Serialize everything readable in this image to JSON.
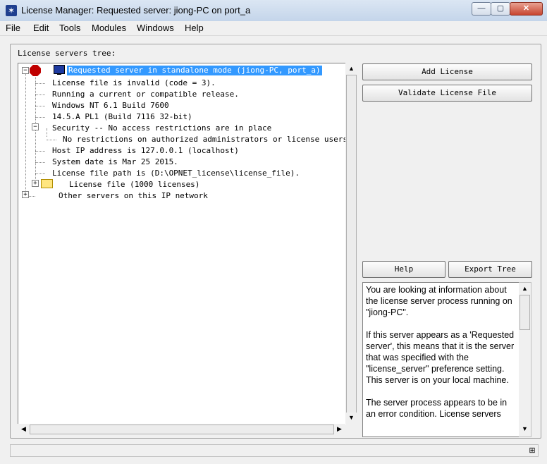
{
  "window": {
    "title": "License Manager: Requested server: jiong-PC on port_a",
    "app_icon": "star-icon"
  },
  "window_controls": {
    "minimize": "—",
    "maximize": "▢",
    "close": "✕"
  },
  "menu": [
    "File",
    "Edit",
    "Tools",
    "Modules",
    "Windows",
    "Help"
  ],
  "tree_label": "License servers tree:",
  "tree": {
    "root": "Requested server in standalone mode (jiong-PC, port_a)",
    "items": [
      "License file is invalid (code = 3).",
      "Running a current or compatible release.",
      "Windows NT 6.1 Build 7600",
      "14.5.A PL1 (Build 7116 32-bit)",
      "Security -- No access restrictions are in place",
      "No restrictions on authorized administrators or license users are i",
      "Host IP address is 127.0.0.1 (localhost)",
      "System date is Mar 25 2015.",
      "License file path is (D:\\OPNET_license\\license_file).",
      "License file (1000 licenses)",
      "Other servers on this IP network"
    ]
  },
  "buttons": {
    "add": "Add License",
    "validate": "Validate License File",
    "help": "Help",
    "export": "Export Tree"
  },
  "help_text": "You are looking at information about the license server process running on \"jiong-PC\".\n\nIf this server appears as a 'Requested server', this means that it is the server that was specified with the \"license_server\" preference setting.\nThis server is on your local machine.\n\nThe server process appears to be in an error condition. License servers",
  "colors": {
    "selection": "#3399ff",
    "error_node": "#c00000"
  }
}
